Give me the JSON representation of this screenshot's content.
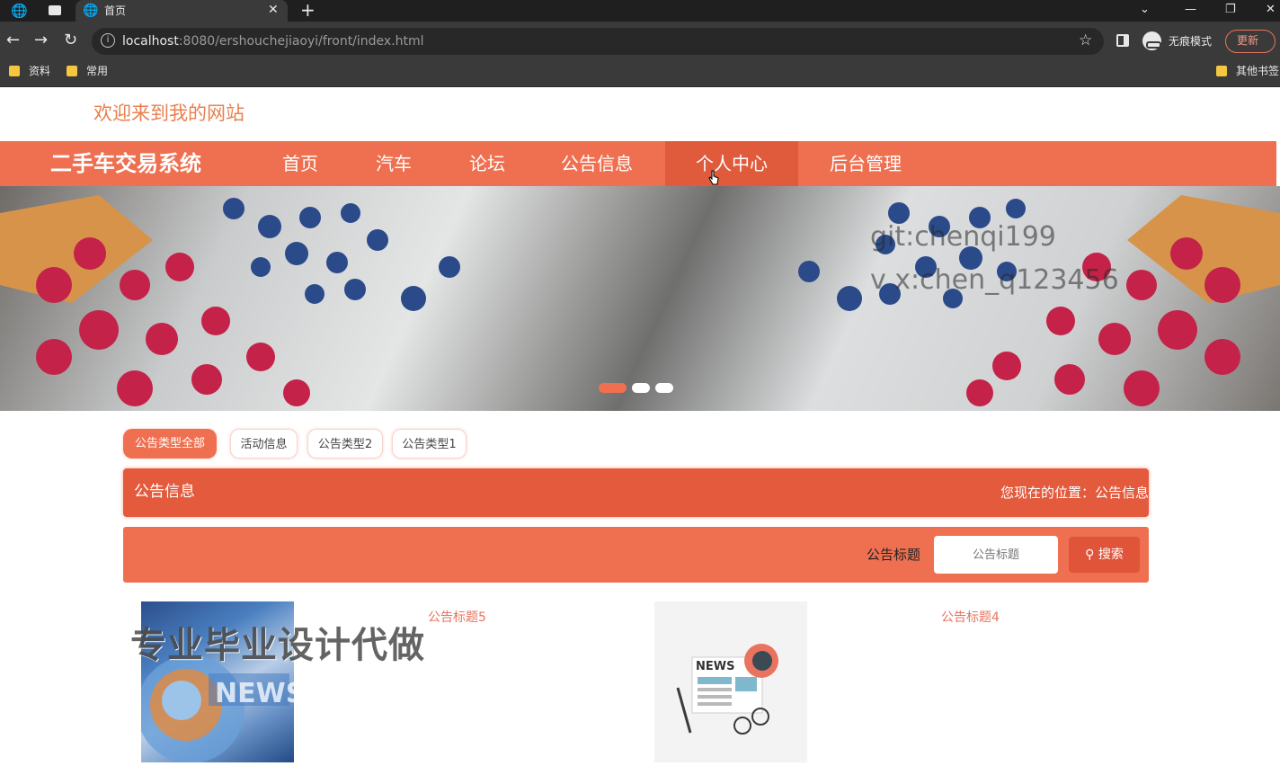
{
  "browser": {
    "tab_title": "首页",
    "url_host": "localhost",
    "url_path": ":8080/ershouchejiaoyi/front/index.html",
    "incognito_label": "无痕模式",
    "update_label": "更新",
    "bookmarks": [
      "资料",
      "常用"
    ],
    "other_bookmarks": "其他书签"
  },
  "site": {
    "welcome": "欢迎来到我的网站",
    "brand": "二手车交易系统",
    "nav": [
      "首页",
      "汽车",
      "论坛",
      "公告信息",
      "个人中心",
      "后台管理"
    ],
    "active_nav": "个人中心"
  },
  "banner": {
    "watermark_lines": [
      "git:chenqi199",
      "v x:chen_q123456"
    ],
    "slides": 3,
    "active_slide": 1
  },
  "type_tabs": [
    "公告类型全部",
    "活动信息",
    "公告类型2",
    "公告类型1"
  ],
  "breadcrumb": {
    "title": "公告信息",
    "location": "您现在的位置：公告信息"
  },
  "search": {
    "label": "公告标题",
    "placeholder": "公告标题",
    "button": "搜索"
  },
  "news": [
    {
      "title": "公告标题5",
      "thumb": "NEWS"
    },
    {
      "title": "公告标题4",
      "thumb": "NEWS"
    }
  ],
  "overlay": "专业毕业设计代做",
  "colors": {
    "accent": "#ef7050",
    "accent_dark": "#e35a3c",
    "welcome": "#e8804f"
  }
}
